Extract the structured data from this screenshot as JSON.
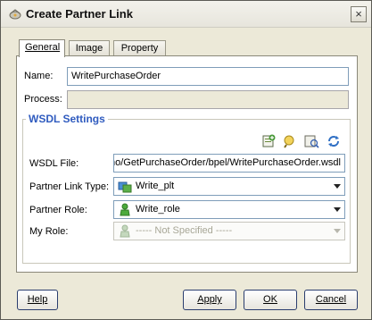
{
  "window": {
    "title": "Create Partner Link",
    "close_label": "×"
  },
  "tabs": [
    {
      "label": "General",
      "active": true
    },
    {
      "label": "Image",
      "active": false
    },
    {
      "label": "Property",
      "active": false
    }
  ],
  "form": {
    "name": {
      "label": "Name:",
      "value": "WritePurchaseOrder"
    },
    "process": {
      "label": "Process:",
      "value": ""
    }
  },
  "wsdl": {
    "group_title": "WSDL Settings",
    "toolbar_icons": [
      "add-wsdl-icon",
      "browse-icon",
      "service-explorer-icon",
      "refresh-icon"
    ],
    "wsdl_file": {
      "label": "WSDL File:",
      "value": "no/GetPurchaseOrder/bpel/WritePurchaseOrder.wsdl"
    },
    "partner_link_type": {
      "label": "Partner Link Type:",
      "value": "Write_plt"
    },
    "partner_role": {
      "label": "Partner Role:",
      "value": "Write_role"
    },
    "my_role": {
      "label": "My Role:",
      "value": "----- Not Specified -----"
    }
  },
  "buttons": {
    "help": "Help",
    "apply": "Apply",
    "ok": "OK",
    "cancel": "Cancel"
  },
  "colors": {
    "dialog_background": "#ece9d8",
    "group_title": "#2f5bbf",
    "field_border": "#7f9db9",
    "button_border": "#2a3d6e"
  }
}
